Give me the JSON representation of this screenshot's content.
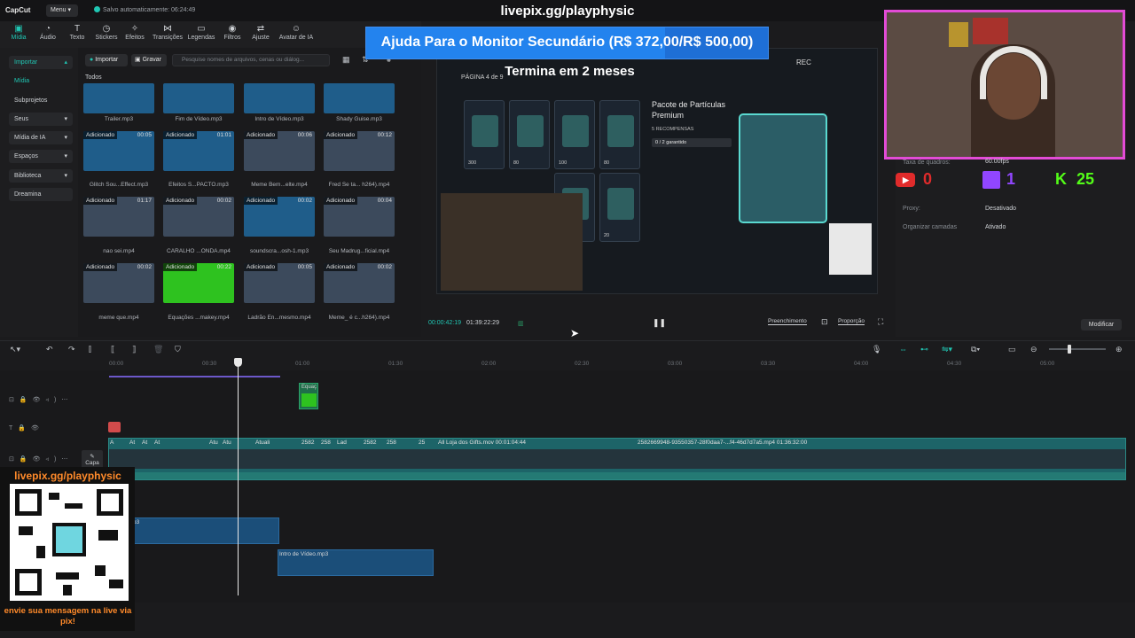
{
  "app": {
    "brand": "CapCut",
    "menu_label": "Menu",
    "autosave": "Salvo automaticamente: 06:24:49"
  },
  "stream": {
    "url": "livepix.gg/playphysic",
    "donation_text": "Ajuda Para o Monitor Secundário (R$ 372,00/R$ 500,00)",
    "donation_progress": 0.744,
    "qr_url": "livepix.gg/playphysic",
    "qr_message": "envie sua mensagem na live via pix!",
    "counters": [
      {
        "platform": "youtube-icon",
        "value": "0",
        "color": "#e02b2b"
      },
      {
        "platform": "twitch-icon",
        "value": "1",
        "color": "#9146ff"
      },
      {
        "platform": "kick-icon",
        "value": "25",
        "color": "#53fc18"
      }
    ]
  },
  "toolbar": {
    "tools": [
      {
        "label": "Mídia",
        "icon": "media-icon",
        "active": true
      },
      {
        "label": "Áudio",
        "icon": "audio-icon"
      },
      {
        "label": "Texto",
        "icon": "text-icon"
      },
      {
        "label": "Stickers",
        "icon": "sticker-icon"
      },
      {
        "label": "Efeitos",
        "icon": "effects-icon"
      },
      {
        "label": "Transições",
        "icon": "transitions-icon"
      },
      {
        "label": "Legendas",
        "icon": "captions-icon"
      },
      {
        "label": "Filtros",
        "icon": "filters-icon"
      },
      {
        "label": "Ajuste",
        "icon": "adjust-icon"
      },
      {
        "label": "Avatar de IA",
        "icon": "avatar-icon"
      }
    ]
  },
  "sidebar": {
    "items": [
      {
        "label": "Importar"
      },
      {
        "label": "Mídia"
      },
      {
        "label": "Subprojetos"
      },
      {
        "label": "Seus"
      },
      {
        "label": "Mídia de IA"
      },
      {
        "label": "Espaços"
      },
      {
        "label": "Biblioteca"
      },
      {
        "label": "Dreamina"
      }
    ]
  },
  "media": {
    "import_label": "Importar",
    "record_label": "Gravar",
    "search_placeholder": "Pesquise nomes de arquivos, cenas ou diálog...",
    "section_label": "Todos",
    "rows": [
      [
        {
          "name": "Trailer.mp3",
          "kind": "audio"
        },
        {
          "name": "Fim de Vídeo.mp3",
          "kind": "audio"
        },
        {
          "name": "Intro de Vídeo.mp3",
          "kind": "audio"
        },
        {
          "name": "Shady Guise.mp3",
          "kind": "audio"
        }
      ],
      [
        {
          "name": "Glitch Sou...Effect.mp3",
          "kind": "audio",
          "badge": "Adicionado",
          "duration": "00:05"
        },
        {
          "name": "Efeitos S...PACTO.mp3",
          "kind": "audio",
          "badge": "Adicionado",
          "duration": "01:01"
        },
        {
          "name": "Meme Bem...elte.mp4",
          "kind": "video",
          "badge": "Adicionado",
          "duration": "00:06"
        },
        {
          "name": "Fred Se ta... h264).mp4",
          "kind": "video",
          "badge": "Adicionado",
          "duration": "00:12"
        }
      ],
      [
        {
          "name": "nao sei.mp4",
          "kind": "video",
          "badge": "Adicionado",
          "duration": "01:17"
        },
        {
          "name": "CARALHO ...ONDA.mp4",
          "kind": "video",
          "badge": "Adicionado",
          "duration": "00:02"
        },
        {
          "name": "soundscra...osh-1.mp3",
          "kind": "audio",
          "badge": "Adicionado",
          "duration": "00:02"
        },
        {
          "name": "Seu Madrug...ficial.mp4",
          "kind": "video",
          "badge": "Adicionado",
          "duration": "00:04"
        }
      ],
      [
        {
          "name": "meme que.mp4",
          "kind": "video",
          "badge": "Adicionado",
          "duration": "00:02"
        },
        {
          "name": "Equações ...makey.mp4",
          "kind": "green",
          "badge": "Adicionado",
          "duration": "00:22"
        },
        {
          "name": "Ladrão En...mesmo.mp4",
          "kind": "video",
          "badge": "Adicionado",
          "duration": "00:05"
        },
        {
          "name": "Meme_ é c...h264).mp4",
          "kind": "video",
          "badge": "Adicionado",
          "duration": "00:02"
        }
      ]
    ]
  },
  "player": {
    "frame_title": "Termina em 2 meses",
    "page_label": "PÁGINA 4 de 9",
    "rec_label": "REC",
    "pack_title": "Pacote de Partículas Premium",
    "pack_rewards": "5 RECOMPENSAS",
    "pack_progress": "0 / 2 garantido",
    "card_values": [
      "300",
      "80",
      "100",
      "80",
      "",
      "",
      "20",
      "20"
    ],
    "current_time": "00:00:42:19",
    "total_time": "01:39:22:29",
    "fill_label": "Preenchimento",
    "ratio_label": "Proporção"
  },
  "details": {
    "rows": [
      {
        "label": "Taxa de quadros:",
        "value": "60.00fps"
      },
      {
        "label": "Proxy:",
        "value": "Desativado"
      },
      {
        "label": "Organizar camadas",
        "value": "Ativado"
      }
    ],
    "modify_label": "Modificar"
  },
  "timeline": {
    "ruler": [
      "00:00",
      "00:30",
      "01:00",
      "01:30",
      "02:00",
      "02:30",
      "03:00",
      "03:30",
      "04:00",
      "04:30",
      "05:00"
    ],
    "equac_label": "Equaç",
    "capa_label": "Capa",
    "clip_labels": [
      "A",
      "At",
      "At",
      "At",
      "Atu",
      "Atu",
      "Atuali",
      "2582",
      "258",
      "Lad",
      "2582",
      "258",
      "25",
      "All Loja dos Gifts.mov  00:01:04:44",
      "2582669948-93550357-28f0daa7-...f4-46d7d7a5.mp4  01:36:32:00"
    ],
    "audio1_label": "p3",
    "audio2_label": "Intro de Vídeo.mp3"
  }
}
